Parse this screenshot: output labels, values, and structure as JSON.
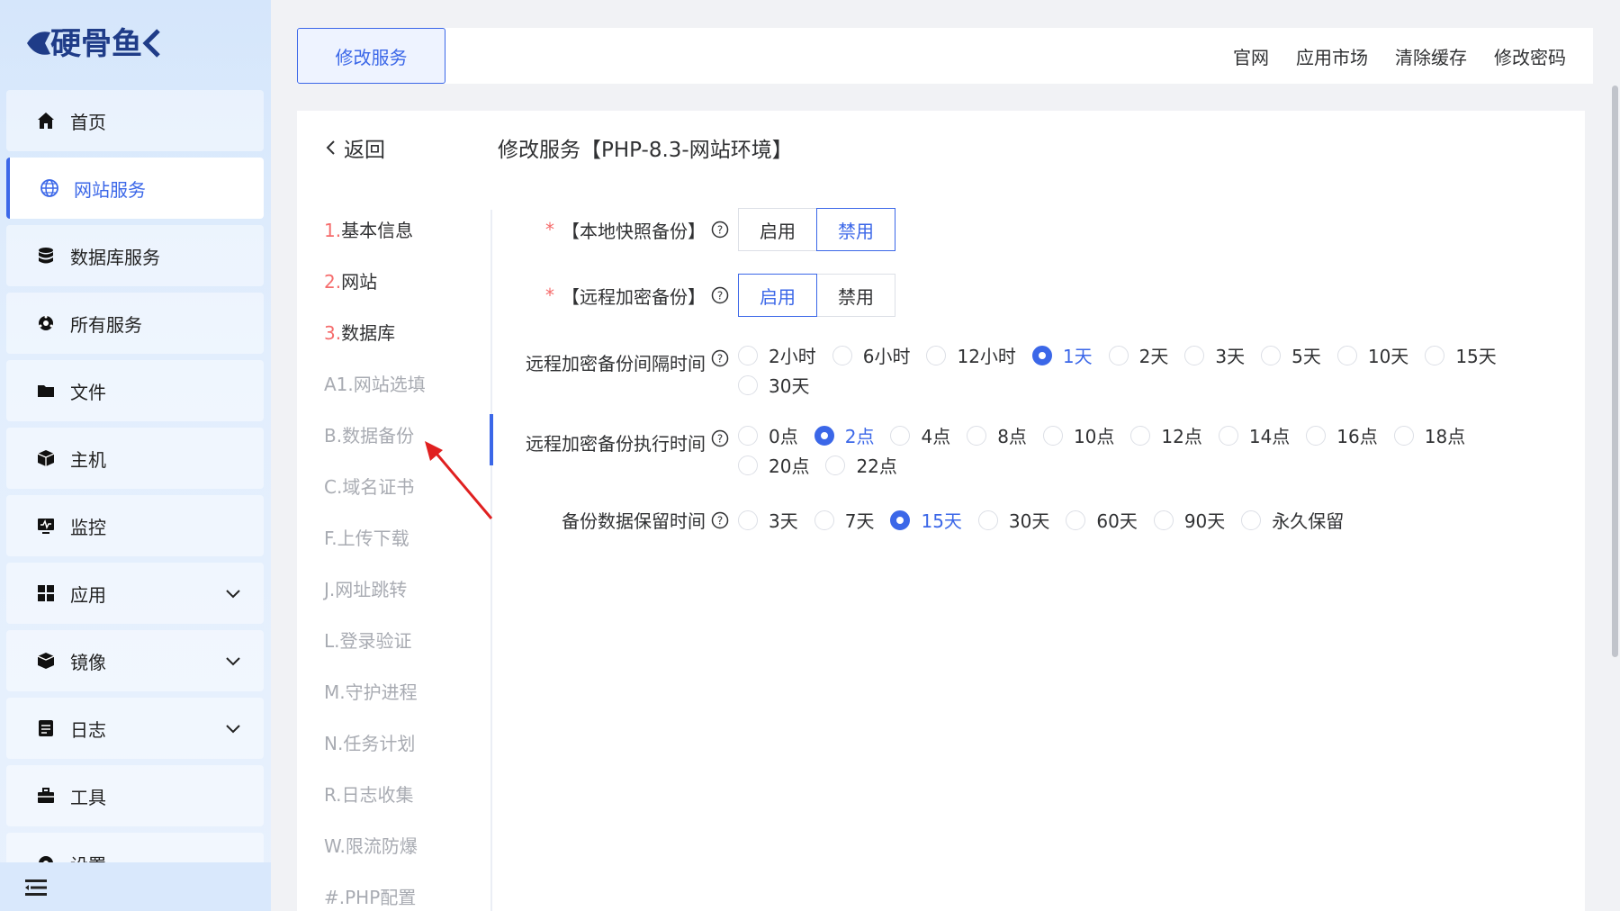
{
  "brand": {
    "logo_text": "硬骨鱼",
    "accent": "#3b67e8"
  },
  "sidebar": {
    "items": [
      {
        "label": "首页",
        "icon": "home-icon",
        "active": false,
        "expandable": false
      },
      {
        "label": "网站服务",
        "icon": "globe-icon",
        "active": true,
        "expandable": false
      },
      {
        "label": "数据库服务",
        "icon": "database-icon",
        "active": false,
        "expandable": false
      },
      {
        "label": "所有服务",
        "icon": "services-icon",
        "active": false,
        "expandable": false
      },
      {
        "label": "文件",
        "icon": "folder-icon",
        "active": false,
        "expandable": false
      },
      {
        "label": "主机",
        "icon": "host-icon",
        "active": false,
        "expandable": false
      },
      {
        "label": "监控",
        "icon": "monitor-icon",
        "active": false,
        "expandable": false
      },
      {
        "label": "应用",
        "icon": "apps-icon",
        "active": false,
        "expandable": true
      },
      {
        "label": "镜像",
        "icon": "image-box-icon",
        "active": false,
        "expandable": true
      },
      {
        "label": "日志",
        "icon": "log-icon",
        "active": false,
        "expandable": true
      },
      {
        "label": "工具",
        "icon": "toolbox-icon",
        "active": false,
        "expandable": false
      },
      {
        "label": "设置",
        "icon": "settings-icon",
        "active": false,
        "expandable": false
      }
    ]
  },
  "header": {
    "tab_label": "修改服务",
    "links": [
      "官网",
      "应用市场",
      "清除缓存",
      "修改密码"
    ]
  },
  "page": {
    "back_label": "返回",
    "title": "修改服务【PHP-8.3-网站环境】"
  },
  "subnav": {
    "items": [
      {
        "num": "1.",
        "text": "基本信息"
      },
      {
        "num": "2.",
        "text": "网站"
      },
      {
        "num": "3.",
        "text": "数据库"
      },
      {
        "num": "",
        "text": "A1.网站选填"
      },
      {
        "num": "",
        "text": "B.数据备份"
      },
      {
        "num": "",
        "text": "C.域名证书"
      },
      {
        "num": "",
        "text": "F.上传下载"
      },
      {
        "num": "",
        "text": "J.网址跳转"
      },
      {
        "num": "",
        "text": "L.登录验证"
      },
      {
        "num": "",
        "text": "M.守护进程"
      },
      {
        "num": "",
        "text": "N.任务计划"
      },
      {
        "num": "",
        "text": "R.日志收集"
      },
      {
        "num": "",
        "text": "W.限流防爆"
      },
      {
        "num": "",
        "text": "#.PHP配置"
      }
    ]
  },
  "form": {
    "local_snapshot": {
      "label": "【本地快照备份】",
      "options": [
        "启用",
        "禁用"
      ],
      "selected": "禁用"
    },
    "remote_encrypt": {
      "label": "【远程加密备份】",
      "options": [
        "启用",
        "禁用"
      ],
      "selected": "启用"
    },
    "interval": {
      "label": "远程加密备份间隔时间",
      "options": [
        "2小时",
        "6小时",
        "12小时",
        "1天",
        "2天",
        "3天",
        "5天",
        "10天",
        "15天",
        "30天"
      ],
      "selected": "1天"
    },
    "exec_time": {
      "label": "远程加密备份执行时间",
      "options": [
        "0点",
        "2点",
        "4点",
        "8点",
        "10点",
        "12点",
        "14点",
        "16点",
        "18点",
        "20点",
        "22点"
      ],
      "selected": "2点"
    },
    "retention": {
      "label": "备份数据保留时间",
      "options": [
        "3天",
        "7天",
        "15天",
        "30天",
        "60天",
        "90天",
        "永久保留"
      ],
      "selected": "15天"
    }
  }
}
